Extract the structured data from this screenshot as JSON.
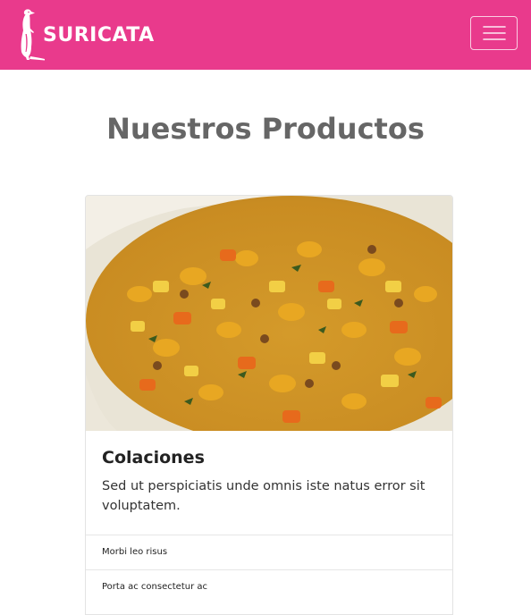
{
  "navbar": {
    "brand_name": "SURICATA",
    "logo_icon": "meerkat-icon",
    "menu_icon": "hamburger-icon",
    "background_color": "#e93a8c"
  },
  "main": {
    "section_title": "Nuestros Productos"
  },
  "product_card": {
    "image_icon": "food-photo",
    "title": "Colaciones",
    "description": "Sed ut perspiciatis unde omnis iste natus error sit voluptatem.",
    "list_items": [
      "Morbi leo risus",
      "Porta ac consectetur ac"
    ]
  }
}
